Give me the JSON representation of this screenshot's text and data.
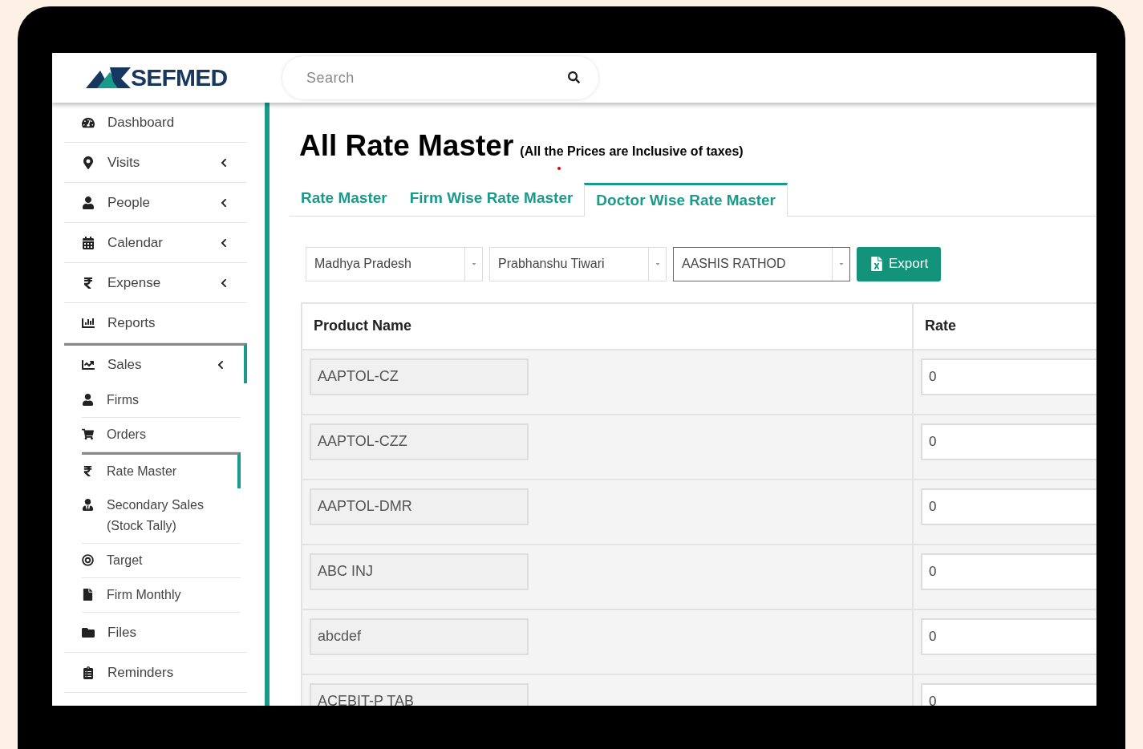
{
  "header": {
    "logo": "SEFMED",
    "search": {
      "placeholder": "Search"
    }
  },
  "sidebar": {
    "items": [
      {
        "label": "Dashboard",
        "expandable": false,
        "selected": false
      },
      {
        "label": "Visits",
        "expandable": true,
        "selected": false
      },
      {
        "label": "People",
        "expandable": true,
        "selected": false
      },
      {
        "label": "Calendar",
        "expandable": true,
        "selected": false
      },
      {
        "label": "Expense",
        "expandable": true,
        "selected": false
      },
      {
        "label": "Reports",
        "expandable": false,
        "selected": false
      },
      {
        "label": "Sales",
        "expandable": true,
        "selected": true,
        "children": [
          {
            "label": "Firms",
            "selected": false
          },
          {
            "label": "Orders",
            "selected": false
          },
          {
            "label": "Rate Master",
            "selected": true
          },
          {
            "label": "Secondary Sales (Stock Tally)",
            "selected": false
          },
          {
            "label": "Target",
            "selected": false
          },
          {
            "label": "Firm Monthly",
            "selected": false
          }
        ]
      },
      {
        "label": "Files",
        "expandable": false,
        "selected": false
      },
      {
        "label": "Reminders",
        "expandable": false,
        "selected": false
      }
    ]
  },
  "page": {
    "title": "All Rate Master",
    "subtitle": "(All the Prices are Inclusive of taxes)"
  },
  "tabs": [
    {
      "label": "Rate Master",
      "selected": false
    },
    {
      "label": "Firm Wise Rate Master",
      "selected": false
    },
    {
      "label": "Doctor Wise Rate Master",
      "selected": true
    }
  ],
  "filters": [
    {
      "value": "Madhya Pradesh",
      "focused": false
    },
    {
      "value": "Prabhanshu Tiwari",
      "focused": false
    },
    {
      "value": "AASHIS RATHOD",
      "focused": true
    }
  ],
  "export_button": "Export",
  "table": {
    "columns": [
      "Product Name",
      "Rate"
    ],
    "rows": [
      {
        "product": "AAPTOL-CZ",
        "rate": "0"
      },
      {
        "product": "AAPTOL-CZZ",
        "rate": "0"
      },
      {
        "product": "AAPTOL-DMR",
        "rate": "0"
      },
      {
        "product": "ABC INJ",
        "rate": "0"
      },
      {
        "product": "abcdef",
        "rate": "0"
      },
      {
        "product": "ACEBIT-P TAB",
        "rate": "0"
      }
    ]
  }
}
